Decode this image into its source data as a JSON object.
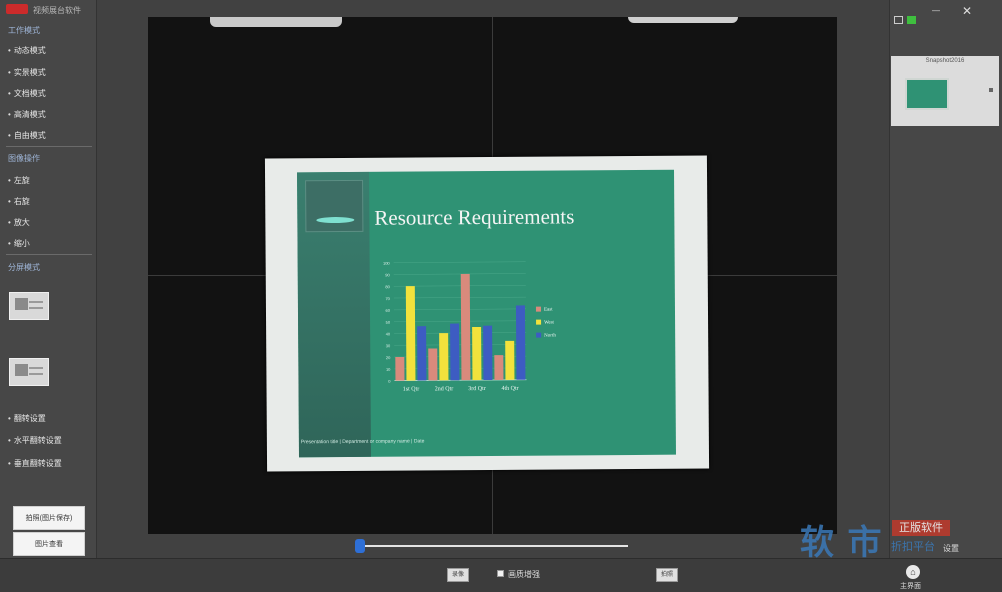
{
  "window": {
    "title": "视频展台软件"
  },
  "sidebar": {
    "section_mode": "工作模式",
    "modes": [
      "动态模式",
      "实景模式",
      "文档模式",
      "高清模式",
      "自由模式"
    ],
    "section_rotate": "图像操作",
    "rotate_items": [
      "左旋",
      "右旋",
      "放大",
      "缩小"
    ],
    "section_layout": "分屏模式",
    "section_mirror": "翻转设置",
    "mirror_items": [
      "水平翻转设置",
      "垂直翻转设置"
    ],
    "button_top": "拍照(图片保存)",
    "button_bottom": "图片查看"
  },
  "slide": {
    "title": "Resource Requirements",
    "footer": "Presentation title  |  Department or company name  |  Date"
  },
  "chart_data": {
    "type": "bar",
    "title": "",
    "categories": [
      "1st Qtr",
      "2nd Qtr",
      "3rd Qtr",
      "4th Qtr"
    ],
    "series": [
      {
        "name": "East",
        "values": [
          20,
          27,
          90,
          21
        ]
      },
      {
        "name": "West",
        "values": [
          80,
          40,
          45,
          33
        ]
      },
      {
        "name": "North",
        "values": [
          46,
          48,
          46,
          63
        ]
      }
    ],
    "colors": [
      "#d98a7c",
      "#f2e23c",
      "#3d5cc2"
    ],
    "ylim": [
      0,
      100
    ],
    "yticks": [
      "0",
      "10",
      "20",
      "30",
      "40",
      "50",
      "60",
      "70",
      "80",
      "90",
      "100"
    ],
    "legend": "right"
  },
  "right_panel": {
    "min_label": "—",
    "close_label": "✕",
    "thumb_caption": "Snapshot2016"
  },
  "bottom": {
    "record_label": "录像",
    "check_label": "画质增强",
    "photo_label": "拍照",
    "home_icon_label": "⌂",
    "home_label": "主界面"
  },
  "watermark": {
    "brand": "软 市",
    "badge": "正版软件",
    "slogan": "折扣平台",
    "side": "设置"
  },
  "colors": {
    "accent": "#2e6fd6",
    "slide_green": "#2f9274",
    "logo_red": "#cc2b2b"
  }
}
